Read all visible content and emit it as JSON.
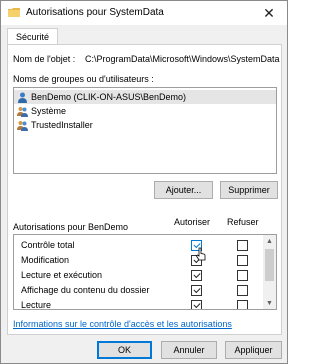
{
  "window": {
    "title": "Autorisations pour SystemData",
    "close_label": "✕"
  },
  "tabs": [
    {
      "label": "Sécurité",
      "active": true
    }
  ],
  "object": {
    "label": "Nom de l'objet :",
    "value": "C:\\ProgramData\\Microsoft\\Windows\\SystemData"
  },
  "groups": {
    "label": "Noms de groupes ou d'utilisateurs :",
    "items": [
      {
        "name": "BenDemo (CLIK-ON-ASUS\\BenDemo)",
        "icon": "user-icon",
        "selected": true
      },
      {
        "name": "Système",
        "icon": "users-group-icon",
        "selected": false
      },
      {
        "name": "TrustedInstaller",
        "icon": "users-group-icon",
        "selected": false
      }
    ]
  },
  "group_buttons": {
    "add": "Ajouter...",
    "remove": "Supprimer"
  },
  "permissions": {
    "label": "Autorisations pour BenDemo",
    "allow_header": "Autoriser",
    "deny_header": "Refuser",
    "items": [
      {
        "name": "Contrôle total",
        "allow": true,
        "deny": false
      },
      {
        "name": "Modification",
        "allow": true,
        "deny": false
      },
      {
        "name": "Lecture et exécution",
        "allow": true,
        "deny": false
      },
      {
        "name": "Affichage du contenu du dossier",
        "allow": true,
        "deny": false
      },
      {
        "name": "Lecture",
        "allow": true,
        "deny": false
      }
    ]
  },
  "link_text": "Informations sur le contrôle d'accès et les autorisations",
  "dialog_buttons": {
    "ok": "OK",
    "cancel": "Annuler",
    "apply": "Appliquer"
  },
  "colors": {
    "accent": "#0078d7",
    "link": "#0066cc",
    "selected_row": "#e5e5e5",
    "window_bg": "#f0f0f0"
  }
}
